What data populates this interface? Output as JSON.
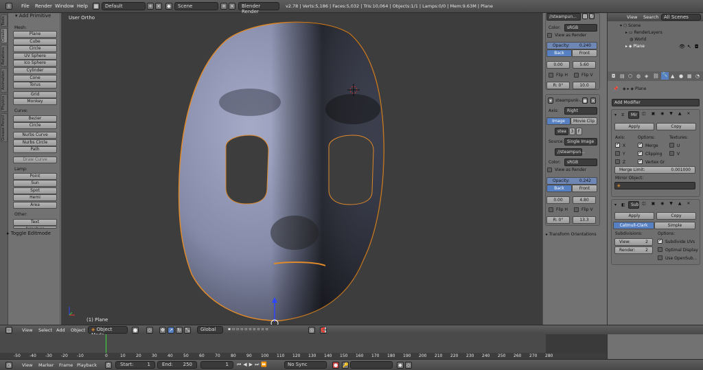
{
  "topbar": {
    "menus": [
      "File",
      "Render",
      "Window",
      "Help"
    ],
    "layout": "Default",
    "scene": "Scene",
    "engine": "Blender Render",
    "stats": "v2.78 | Verts:5,186 | Faces:5,032 | Tris:10,064 | Objects:1/1 | Lamps:0/0 | Mem:9.63M | Plane"
  },
  "toolshelf": {
    "tabs": [
      "Tools",
      "Create",
      "Relations",
      "Animation",
      "Physics",
      "Grease Pencil"
    ],
    "header": "Add Primitive",
    "mesh_label": "Mesh:",
    "mesh": [
      "Plane",
      "Cube",
      "Circle",
      "UV Sphere",
      "Ico Sphere",
      "Cylinder",
      "Cone",
      "Torus"
    ],
    "mesh2": [
      "Grid",
      "Monkey"
    ],
    "curve_label": "Curve:",
    "curve": [
      "Bezier",
      "Circle"
    ],
    "curve2": [
      "Nurbs Curve",
      "Nurbs Circle",
      "Path"
    ],
    "draw_curve": "Draw Curve",
    "lamp_label": "Lamp:",
    "lamp": [
      "Point",
      "Sun",
      "Spot",
      "Hemi",
      "Area"
    ],
    "other_label": "Other:",
    "other": [
      "Text",
      "Armature"
    ],
    "toggle": "Toggle Editmode"
  },
  "viewport": {
    "view_name": "User Ortho",
    "object_label": "(1) Plane"
  },
  "bgpanel": {
    "image1": "//steampun...",
    "color_label": "Color:",
    "color1": "sRGB",
    "view_render": "View as Render",
    "opacity_label": "Opacity:",
    "opacity1": "0.240",
    "back": "Back",
    "front": "Front",
    "x1": "0.00",
    "y1": "5.60",
    "fliph": "Flip H",
    "flipv": "Flip V",
    "rot1": "R: 0°",
    "size1": "10.0",
    "image2_name": "steampunk-...",
    "axis_label": "Axis:",
    "axis": "Right",
    "tab_image": "Image",
    "tab_movie": "Movie Clip",
    "img_block": "stea",
    "users": "3",
    "fake": "F",
    "source_label": "Source:",
    "source": "Single Image",
    "image2": "//steampun...",
    "color2": "sRGB",
    "opacity2": "0.242",
    "x2": "0.00",
    "y2": "4.80",
    "rot2": "R: 0°",
    "size2": "13.3",
    "transform": "Transform Orientations"
  },
  "outliner": {
    "menus": [
      "View",
      "Search"
    ],
    "filter": "All Scenes",
    "items": [
      "Scene",
      "RenderLayers",
      "World",
      "Plane"
    ]
  },
  "properties": {
    "breadcrumb": "Plane",
    "add_modifier": "Add Modifier",
    "mod1": {
      "name": "Mir",
      "apply": "Apply",
      "copy": "Copy",
      "axis_label": "Axis:",
      "options_label": "Options:",
      "textures_label": "Textures:",
      "x": "X",
      "y": "Y",
      "z": "Z",
      "merge": "Merge",
      "clipping": "Clipping",
      "vertex": "Vertex Gr",
      "u": "U",
      "v": "V",
      "merge_limit_label": "Merge Limit:",
      "merge_limit": "0.001000",
      "mirror_obj_label": "Mirror Object:"
    },
    "mod2": {
      "name": "Sub",
      "apply": "Apply",
      "copy": "Copy",
      "catmull": "Catmull-Clark",
      "simple": "Simple",
      "subdiv_label": "Subdivisions:",
      "options_label": "Options:",
      "view_label": "View:",
      "view_val": "2",
      "render_label": "Render:",
      "render_val": "2",
      "opt1": "Subdivide UVs",
      "opt2": "Optimal Display",
      "opt3": "Use OpenSub..."
    }
  },
  "vpheader": {
    "menus": [
      "View",
      "Select",
      "Add",
      "Object"
    ],
    "mode": "Object Mode",
    "orientation": "Global"
  },
  "timeline": {
    "ticks": [
      "-50",
      "-40",
      "-30",
      "-20",
      "-10",
      "0",
      "10",
      "20",
      "30",
      "40",
      "50",
      "60",
      "70",
      "80",
      "90",
      "100",
      "110",
      "120",
      "130",
      "140",
      "150",
      "160",
      "170",
      "180",
      "190",
      "200",
      "210",
      "220",
      "230",
      "240",
      "250",
      "260",
      "270",
      "280"
    ]
  },
  "bottombar": {
    "menus": [
      "View",
      "Marker",
      "Frame",
      "Playback"
    ],
    "start_label": "Start:",
    "start": "1",
    "end_label": "End:",
    "end": "250",
    "current": "1",
    "sync": "No Sync"
  }
}
